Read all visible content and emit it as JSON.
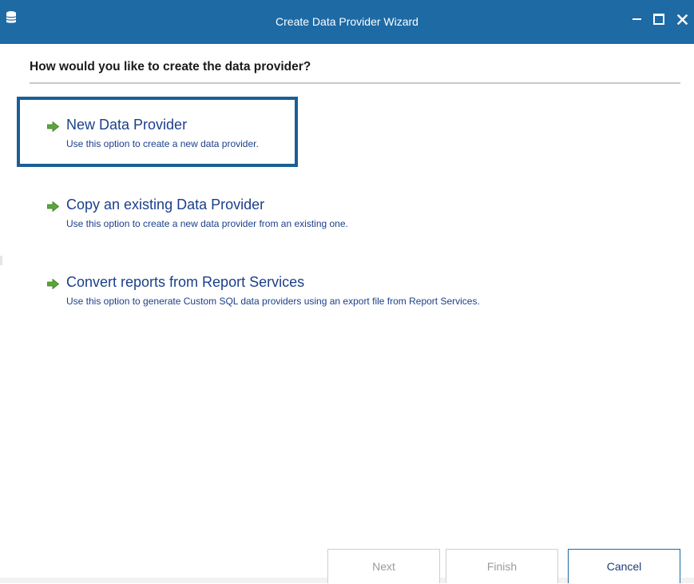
{
  "window": {
    "title": "Create Data Provider Wizard",
    "icon": "database-icon",
    "controls": [
      "minimize-icon",
      "maximize-icon",
      "close-icon"
    ]
  },
  "colors": {
    "titlebar": "#1d6aa5",
    "option_text": "#1b3f8b",
    "selection_border": "#1b5e95",
    "arrow_green": "#5aa63c"
  },
  "question": "How would you like to create the data provider?",
  "options": [
    {
      "title": "New Data Provider",
      "description": "Use this option to create a new data provider.",
      "icon": "green-arrow-icon",
      "selected": true
    },
    {
      "title": "Copy an existing Data Provider",
      "description": "Use this option to create a new data provider from an existing one.",
      "icon": "green-arrow-icon",
      "selected": false
    },
    {
      "title": "Convert reports from Report Services",
      "description": "Use this option to generate Custom SQL data providers using an export file from Report Services.",
      "icon": "green-arrow-icon",
      "selected": false
    }
  ],
  "buttons": {
    "next": "Next",
    "finish": "Finish",
    "cancel": "Cancel"
  }
}
